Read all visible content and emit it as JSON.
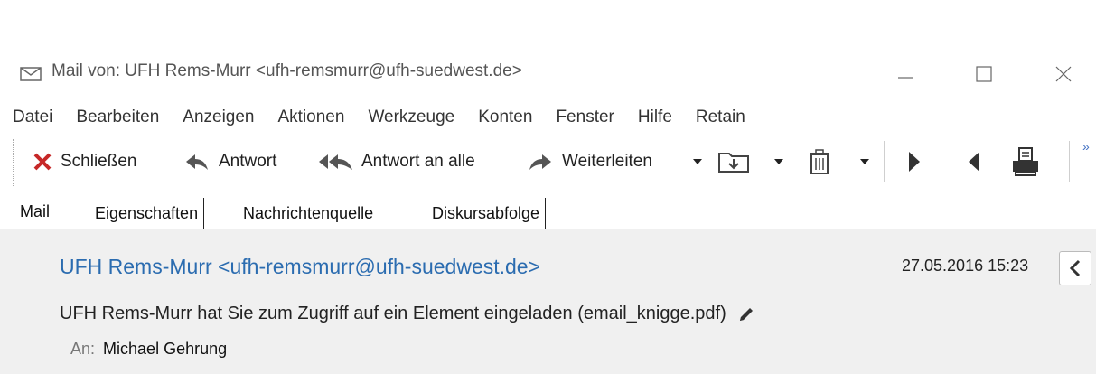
{
  "window": {
    "title": "Mail von: UFH Rems-Murr <ufh-remsmurr@ufh-suedwest.de>"
  },
  "menu": [
    "Datei",
    "Bearbeiten",
    "Anzeigen",
    "Aktionen",
    "Werkzeuge",
    "Konten",
    "Fenster",
    "Hilfe",
    "Retain"
  ],
  "toolbar": {
    "close_label": "Schließen",
    "reply_label": "Antwort",
    "reply_all_label": "Antwort an alle",
    "forward_label": "Weiterleiten",
    "overflow": "»"
  },
  "tabs": [
    "Mail",
    "Eigenschaften",
    "Nachrichtenquelle",
    "Diskursabfolge"
  ],
  "message": {
    "from": "UFH Rems-Murr <ufh-remsmurr@ufh-suedwest.de>",
    "date": "27.05.2016 15:23",
    "subject": "UFH Rems-Murr hat Sie zum Zugriff auf ein Element eingeladen (email_knigge.pdf)",
    "to_label": "An:",
    "to_value": "Michael Gehrung"
  },
  "colors": {
    "accent_link": "#2b6cb0",
    "close_x": "#c62828",
    "header_bg": "#f0f0f0"
  },
  "icons": [
    "mail-icon",
    "minimize-icon",
    "maximize-icon",
    "close-window-icon",
    "close-x-icon",
    "reply-icon",
    "reply-all-icon",
    "forward-icon",
    "move-to-folder-icon",
    "trash-icon",
    "next-icon",
    "previous-icon",
    "print-icon",
    "pencil-icon",
    "chevron-left-icon"
  ]
}
